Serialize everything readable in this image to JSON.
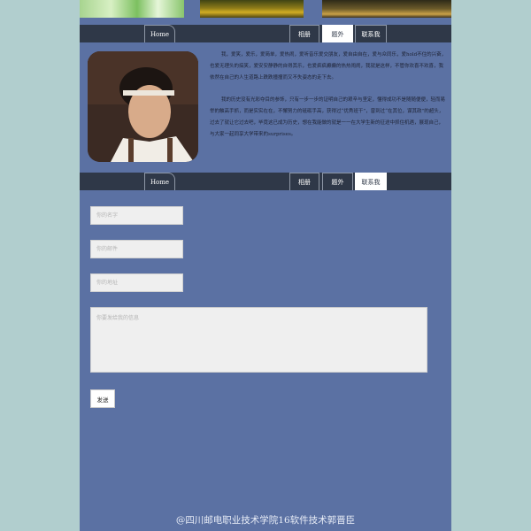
{
  "nav": {
    "home": "Home",
    "album": "相册",
    "extra": "题外",
    "contact": "联系我"
  },
  "about": {
    "paragraph_1": "我，爱笑，爱乐，爱简单，爱热闹，爱听音乐爱交朋友，爱自由自在，爱与众同乐，爱hold不住的兴奋，也爱无理头的搞笑，爱安安静静的自得其乐，也爱疯疯癫癫的热热闹闹，我就是这样，不管你欢喜不欢喜，我依然在自己的人生道路上跌跌撞撞而又不失姿态的走下去。",
    "paragraph_2": "我的历史没有光彩夺目的参饰，只有一步一步的证明自己的艰辛与坚定，懂得成功不是随随便便，轻而易举的触高手抓，而是实实在在，不懈努力的砥砺手高，获得过“优秀班干”，曾到过“在其位，谋其政”的超头，过去了就让它过去吧，毕竟这已成为历史，想在我能做的就是一一在大学生新的征途中抓住机遇，展现自己，与大家一起同享大学带来的surprises。"
  },
  "form": {
    "name_placeholder": "你的名字",
    "email_placeholder": "你的邮件",
    "address_placeholder": "你的地址",
    "message_placeholder": "你要发给我的信息",
    "send_label": "发送"
  },
  "footer": {
    "text": "@四川邮电职业技术学院16软件技术郭晋臣"
  },
  "colors": {
    "page_background": "#b1cece",
    "content_background": "#5b71a3",
    "nav_background": "#2f3848",
    "active_tab": "#ffffff"
  }
}
